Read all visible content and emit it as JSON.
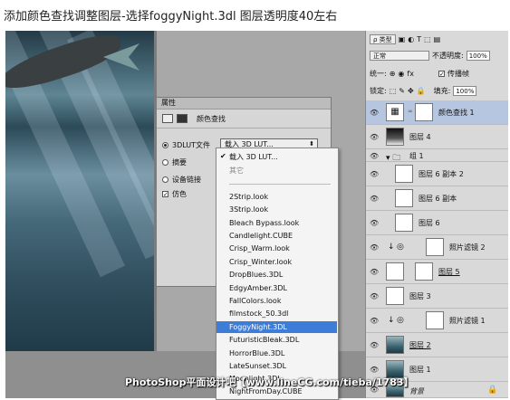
{
  "caption": "添加颜色查找调整图层-选择foggyNight.3dl 图层透明度40左右",
  "watermark": "PhotoShop平面设计吧【www.lineCG.com/tieba/1783】",
  "properties_panel": {
    "title": "属性",
    "header_label": "颜色查找",
    "options": [
      {
        "label": "3DLUT文件",
        "state": "on"
      },
      {
        "label": "摘要",
        "state": "off"
      },
      {
        "label": "设备链接",
        "state": "off"
      },
      {
        "label": "仿色",
        "state": "checked"
      }
    ],
    "select_value": "载入 3D LUT..."
  },
  "dropdown": {
    "top_items": [
      "载入 3D LUT...",
      "其它"
    ],
    "items": [
      "2Strip.look",
      "3Strip.look",
      "Bleach Bypass.look",
      "Candlelight.CUBE",
      "Crisp_Warm.look",
      "Crisp_Winter.look",
      "DropBlues.3DL",
      "EdgyAmber.3DL",
      "FallColors.look",
      "filmstock_50.3dl",
      "FoggyNight.3DL",
      "FuturisticBleak.3DL",
      "HorrorBlue.3DL",
      "LateSunset.3DL",
      "Moonlight.3DL",
      "NightFromDay.CUBE"
    ],
    "selected": "FoggyNight.3DL"
  },
  "layers_panel": {
    "filter_label": "ρ 类型",
    "mode": "正常",
    "opacity_label": "不透明度:",
    "opacity_value": "100%",
    "lock_unify_label": "统一:",
    "propagate_label": "传播帧",
    "lock_label": "锁定:",
    "fill_label": "填充:",
    "fill_value": "100%",
    "layers": [
      {
        "name": "颜色查找 1",
        "thumb": "grid",
        "active": true
      },
      {
        "name": "图层 4",
        "thumb": "dark"
      },
      {
        "name": "组 1",
        "thumb": "folder"
      },
      {
        "name": "图层 6 副本 2",
        "thumb": "fig"
      },
      {
        "name": "图层 6 副本",
        "thumb": "fig"
      },
      {
        "name": "图层 6",
        "thumb": "fig"
      },
      {
        "name": "照片滤镜 2",
        "thumb": "adj"
      },
      {
        "name": "图层 5",
        "thumb": "fig"
      },
      {
        "name": "图层 3",
        "thumb": "fig"
      },
      {
        "name": "照片滤镜 1",
        "thumb": "adj"
      },
      {
        "name": "图层 2",
        "thumb": "scene"
      },
      {
        "name": "图层 1",
        "thumb": "scene"
      },
      {
        "name": "背景",
        "thumb": "scene"
      }
    ]
  }
}
